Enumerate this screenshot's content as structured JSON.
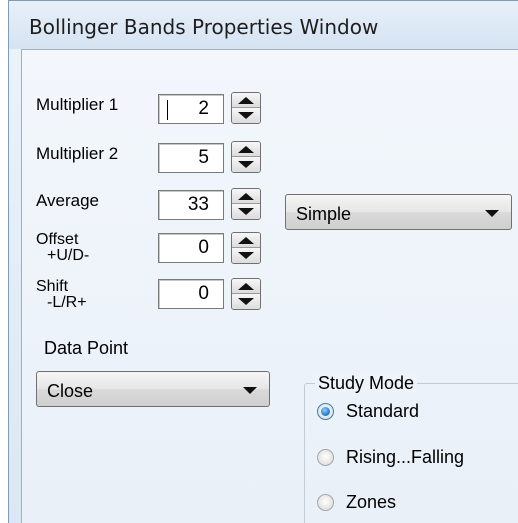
{
  "window": {
    "title": "Bollinger Bands Properties Window"
  },
  "fields": {
    "multiplier1": {
      "label": "Multiplier 1",
      "value": "2"
    },
    "multiplier2": {
      "label": "Multiplier 2",
      "value": "5"
    },
    "average": {
      "label": "Average",
      "value": "33"
    },
    "offset": {
      "label_line1": "Offset",
      "label_line2": "+U/D-",
      "value": "0"
    },
    "shift": {
      "label_line1": "Shift",
      "label_line2": "-L/R+",
      "value": "0"
    }
  },
  "average_type": {
    "selected": "Simple"
  },
  "data_point": {
    "label": "Data Point",
    "selected": "Close"
  },
  "study_mode": {
    "legend": "Study Mode",
    "options": [
      "Standard",
      "Rising...Falling",
      "Zones"
    ],
    "selected": "Standard"
  },
  "icons": {
    "spinner_up": "triangle-up-icon",
    "spinner_down": "triangle-down-icon",
    "dropdown": "chevron-down-icon"
  },
  "colors": {
    "selected_radio": "#2d86d6",
    "window_border": "#7f9db9"
  }
}
